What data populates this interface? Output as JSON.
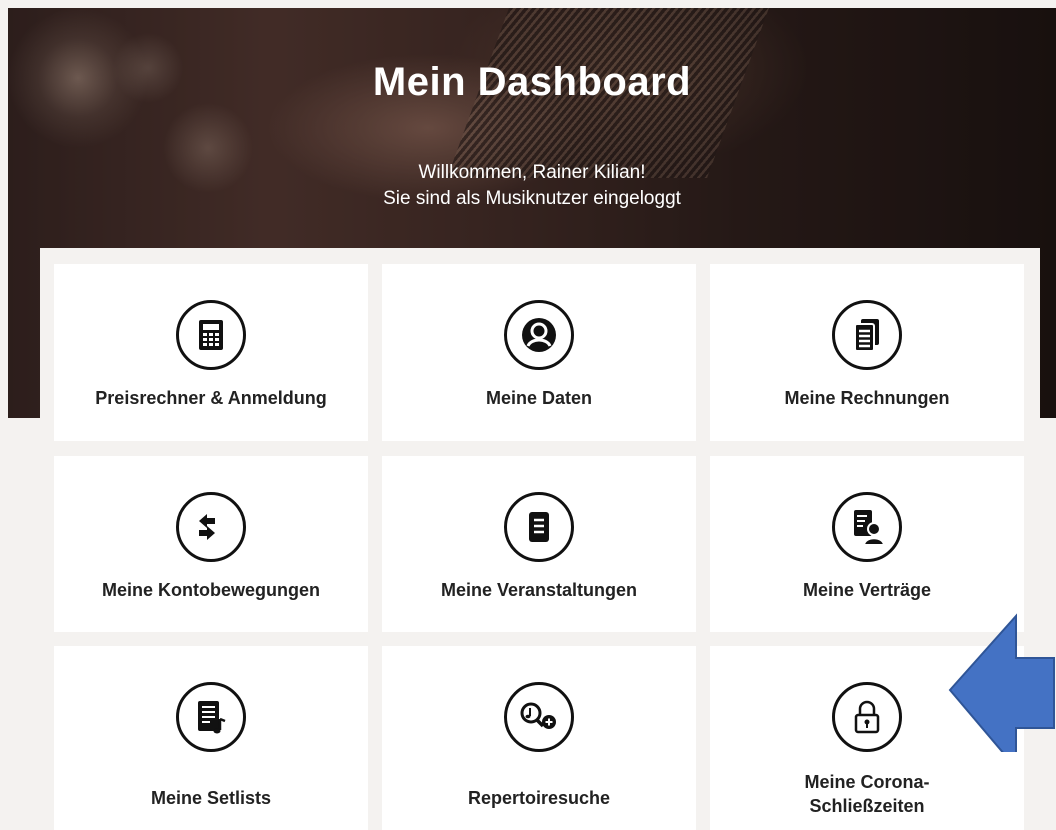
{
  "header": {
    "title": "Mein Dashboard",
    "welcome_line": "Willkommen, Rainer Kilian!",
    "status_line": "Sie sind als Musiknutzer eingeloggt"
  },
  "tiles": [
    {
      "label": "Preisrechner & Anmeldung",
      "icon": "calculator-icon"
    },
    {
      "label": "Meine Daten",
      "icon": "user-icon"
    },
    {
      "label": "Meine Rechnungen",
      "icon": "invoices-icon"
    },
    {
      "label": "Meine Kontobewegungen",
      "icon": "transfer-arrows-icon"
    },
    {
      "label": "Meine Veranstaltungen",
      "icon": "document-icon"
    },
    {
      "label": "Meine Verträge",
      "icon": "contract-person-icon"
    },
    {
      "label": "Meine Setlists",
      "icon": "setlist-music-icon"
    },
    {
      "label": "Repertoiresuche",
      "icon": "music-search-icon"
    },
    {
      "label": "Meine Corona-\nSchließzeiten",
      "line1": "Meine Corona-",
      "line2": "Schließzeiten",
      "icon": "padlock-icon"
    }
  ],
  "colors": {
    "annotation_arrow": "#4472c4",
    "tile_background": "#ffffff",
    "page_background": "#f4f2f0"
  }
}
